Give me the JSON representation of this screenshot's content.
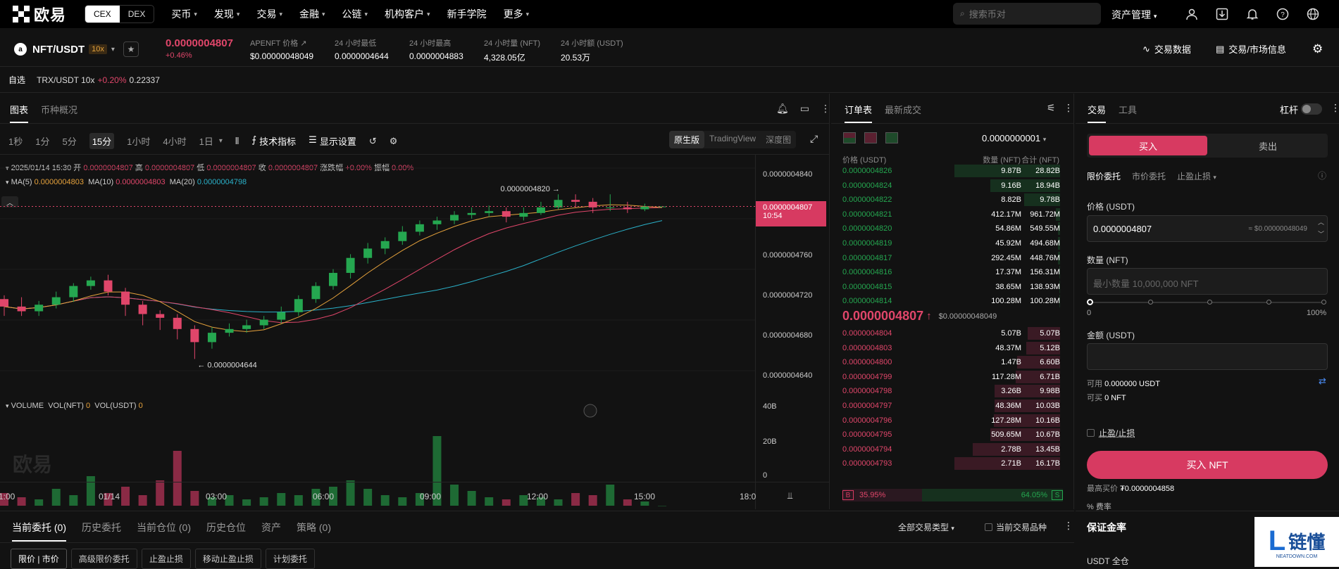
{
  "topnav": {
    "logo": "欧易",
    "segments": [
      "CEX",
      "DEX"
    ],
    "menu": [
      "买币",
      "发现",
      "交易",
      "金融",
      "公链",
      "机构客户",
      "新手学院",
      "更多"
    ],
    "menu_has_caret": [
      true,
      true,
      true,
      true,
      true,
      true,
      false,
      true
    ],
    "search_placeholder": "搜索币对",
    "asset_mgmt": "资产管理"
  },
  "ticker": {
    "pair": "NFT/USDT",
    "coin_glyph": "a",
    "leverage": "10x",
    "price": "0.0000004807",
    "change": "+0.46%",
    "stats": [
      {
        "label": "APENFT 价格 ↗",
        "value": "$0.00000048049"
      },
      {
        "label": "24 小时最低",
        "value": "0.0000004644"
      },
      {
        "label": "24 小时最高",
        "value": "0.0000004883"
      },
      {
        "label": "24 小时量 (NFT)",
        "value": "4,328.05亿"
      },
      {
        "label": "24 小时额 (USDT)",
        "value": "20.53万"
      }
    ],
    "trade_data": "交易数据",
    "market_info": "交易/市场信息"
  },
  "watchlist": {
    "label": "自选",
    "item_pair": "TRX/USDT 10x",
    "item_change": "+0.20%",
    "item_price": "0.22337"
  },
  "chart": {
    "tabs": [
      "图表",
      "币种概况"
    ],
    "timeframes": [
      "1秒",
      "1分",
      "5分",
      "15分",
      "1小时",
      "4小时",
      "1日"
    ],
    "active_tf": "15分",
    "indicators": "技术指标",
    "display_settings": "显示设置",
    "views": [
      "原生版",
      "TradingView",
      "深度图"
    ],
    "ohlc": {
      "time": "2025/01/14 15:30",
      "open_label": "开",
      "open": "0.0000004807",
      "high_label": "高",
      "high": "0.0000004807",
      "low_label": "低",
      "low": "0.0000004807",
      "close_label": "收",
      "close": "0.0000004807",
      "chg_label": "涨跌幅",
      "chg": "+0.00%",
      "amp_label": "振幅",
      "amp": "0.00%"
    },
    "ma": {
      "ma5_label": "MA(5)",
      "ma5": "0.0000004803",
      "ma10_label": "MA(10)",
      "ma10": "0.0000004803",
      "ma20_label": "MA(20)",
      "ma20": "0.0000004798"
    },
    "price_axis": [
      "0.0000004840",
      "0.0000004760",
      "0.0000004720",
      "0.0000004680",
      "0.0000004640"
    ],
    "current_price": "0.0000004807",
    "countdown": "10:54",
    "high_marker": "0.0000004820 →",
    "low_marker": "← 0.0000004644",
    "volume_label": "VOLUME",
    "vol_nft_label": "VOL(NFT)",
    "vol_nft": "0",
    "vol_usdt_label": "VOL(USDT)",
    "vol_usdt": "0",
    "volume_axis": [
      "40B",
      "20B",
      "0"
    ],
    "time_axis": [
      "1:00",
      "01/14",
      "03:00",
      "06:00",
      "09:00",
      "12:00",
      "15:00",
      "18:0"
    ],
    "watermark": "欧易"
  },
  "chart_data": {
    "type": "candlestick",
    "ylim": [
      4.63e-07,
      4.848e-07
    ],
    "candles": [
      [
        4708,
        4700,
        4712,
        4690
      ],
      [
        4700,
        4695,
        4710,
        4690
      ],
      [
        4695,
        4702,
        4706,
        4690
      ],
      [
        4702,
        4710,
        4716,
        4698
      ],
      [
        4710,
        4722,
        4725,
        4705
      ],
      [
        4722,
        4728,
        4732,
        4718
      ],
      [
        4728,
        4716,
        4734,
        4712
      ],
      [
        4716,
        4702,
        4720,
        4690
      ],
      [
        4702,
        4692,
        4706,
        4680
      ],
      [
        4692,
        4688,
        4696,
        4675
      ],
      [
        4688,
        4676,
        4692,
        4665
      ],
      [
        4676,
        4662,
        4680,
        4644
      ],
      [
        4662,
        4672,
        4678,
        4655
      ],
      [
        4672,
        4676,
        4682,
        4668
      ],
      [
        4676,
        4680,
        4686,
        4672
      ],
      [
        4680,
        4686,
        4690,
        4676
      ],
      [
        4686,
        4694,
        4700,
        4682
      ],
      [
        4694,
        4708,
        4712,
        4690
      ],
      [
        4708,
        4722,
        4726,
        4704
      ],
      [
        4722,
        4736,
        4740,
        4718
      ],
      [
        4736,
        4752,
        4756,
        4730
      ],
      [
        4752,
        4762,
        4768,
        4746
      ],
      [
        4762,
        4770,
        4774,
        4756
      ],
      [
        4770,
        4780,
        4786,
        4766
      ],
      [
        4780,
        4788,
        4792,
        4776
      ],
      [
        4788,
        4792,
        4796,
        4782
      ],
      [
        4792,
        4798,
        4802,
        4788
      ],
      [
        4798,
        4800,
        4806,
        4794
      ],
      [
        4800,
        4802,
        4808,
        4796
      ],
      [
        4802,
        4796,
        4806,
        4790
      ],
      [
        4796,
        4800,
        4806,
        4792
      ],
      [
        4800,
        4806,
        4812,
        4798
      ],
      [
        4806,
        4814,
        4820,
        4804
      ],
      [
        4814,
        4812,
        4820,
        4806
      ],
      [
        4812,
        4806,
        4816,
        4800
      ],
      [
        4806,
        4806,
        4820,
        4802
      ],
      [
        4806,
        4804,
        4812,
        4800
      ],
      [
        4804,
        4807,
        4810,
        4802
      ],
      [
        4807,
        4807,
        4807,
        4807
      ]
    ],
    "volumes": [
      6,
      4,
      3,
      8,
      5,
      14,
      6,
      9,
      5,
      12,
      26,
      7,
      4,
      5,
      3,
      4,
      6,
      5,
      8,
      9,
      12,
      8,
      5,
      4,
      6,
      33,
      10,
      7,
      4,
      3,
      5,
      4,
      3,
      6,
      5,
      10,
      3,
      2,
      0
    ]
  },
  "orderbook": {
    "tabs": [
      "订单表",
      "最新成交"
    ],
    "tick": "0.0000000001",
    "headers": [
      "价格 (USDT)",
      "数量 (NFT)",
      "合计 (NFT)"
    ],
    "asks": [
      {
        "p": "0.0000004826",
        "q": "9.87B",
        "t": "28.82B",
        "d": 1.0
      },
      {
        "p": "0.0000004824",
        "q": "9.16B",
        "t": "18.94B",
        "d": 0.66
      },
      {
        "p": "0.0000004822",
        "q": "8.82B",
        "t": "9.78B",
        "d": 0.34
      },
      {
        "p": "0.0000004821",
        "q": "412.17M",
        "t": "961.72M",
        "d": 0.04
      },
      {
        "p": "0.0000004820",
        "q": "54.86M",
        "t": "549.55M",
        "d": 0.02
      },
      {
        "p": "0.0000004819",
        "q": "45.92M",
        "t": "494.68M",
        "d": 0.02
      },
      {
        "p": "0.0000004817",
        "q": "292.45M",
        "t": "448.76M",
        "d": 0.02
      },
      {
        "p": "0.0000004816",
        "q": "17.37M",
        "t": "156.31M",
        "d": 0.01
      },
      {
        "p": "0.0000004815",
        "q": "38.65M",
        "t": "138.93M",
        "d": 0.01
      },
      {
        "p": "0.0000004814",
        "q": "100.28M",
        "t": "100.28M",
        "d": 0.01
      }
    ],
    "last_price": "0.0000004807",
    "last_usd": "$0.00000048049",
    "bids": [
      {
        "p": "0.0000004804",
        "q": "5.07B",
        "t": "5.07B",
        "d": 0.31
      },
      {
        "p": "0.0000004803",
        "q": "48.37M",
        "t": "5.12B",
        "d": 0.32
      },
      {
        "p": "0.0000004800",
        "q": "1.47B",
        "t": "6.60B",
        "d": 0.41
      },
      {
        "p": "0.0000004799",
        "q": "117.28M",
        "t": "6.71B",
        "d": 0.42
      },
      {
        "p": "0.0000004798",
        "q": "3.26B",
        "t": "9.98B",
        "d": 0.62
      },
      {
        "p": "0.0000004797",
        "q": "48.36M",
        "t": "10.03B",
        "d": 0.62
      },
      {
        "p": "0.0000004796",
        "q": "127.28M",
        "t": "10.16B",
        "d": 0.63
      },
      {
        "p": "0.0000004795",
        "q": "509.65M",
        "t": "10.67B",
        "d": 0.66
      },
      {
        "p": "0.0000004794",
        "q": "2.78B",
        "t": "13.45B",
        "d": 0.83
      },
      {
        "p": "0.0000004793",
        "q": "2.71B",
        "t": "16.17B",
        "d": 1.0
      }
    ],
    "buy_badge": "B",
    "buy_ratio_label": "35.95%",
    "buy_ratio": 0.3595,
    "sell_ratio_label": "64.05%",
    "sell_badge": "S"
  },
  "trade": {
    "tabs": [
      "交易",
      "工具"
    ],
    "leverage_label": "杠杆",
    "buy": "买入",
    "sell": "卖出",
    "order_types": [
      "限价委托",
      "市价委托",
      "止盈止损"
    ],
    "price_label": "价格 (USDT)",
    "price_value": "0.0000004807",
    "price_usd": "≈ $0.00000048049",
    "qty_label": "数量 (NFT)",
    "qty_placeholder": "最小数量 10,000,000 NFT",
    "slider_min": "0",
    "slider_max": "100%",
    "amount_label": "金额 (USDT)",
    "avail_label": "可用",
    "avail_value": "0.000000 USDT",
    "canbuy_label": "可买",
    "canbuy_value": "0 NFT",
    "tpsl": "止盈/止损",
    "buy_btn": "买入 NFT",
    "max_price_label": "最高买价",
    "max_price": "₮0.0000004858",
    "fee_label": "% 费率"
  },
  "bottom": {
    "tabs": [
      "当前委托 (0)",
      "历史委托",
      "当前仓位 (0)",
      "历史仓位",
      "资产",
      "策略 (0)"
    ],
    "trade_type": "全部交易类型",
    "current_only": "当前交易品种",
    "chips": [
      "限价 | 市价",
      "高级限价委托",
      "止盈止损",
      "移动止盈止损",
      "计划委托"
    ]
  },
  "margin": {
    "title": "保证金率",
    "usdt_mode": "USDT 全仓"
  },
  "watermark_logo": {
    "text": "链懂",
    "sub": "NEATDOWN.COM"
  }
}
